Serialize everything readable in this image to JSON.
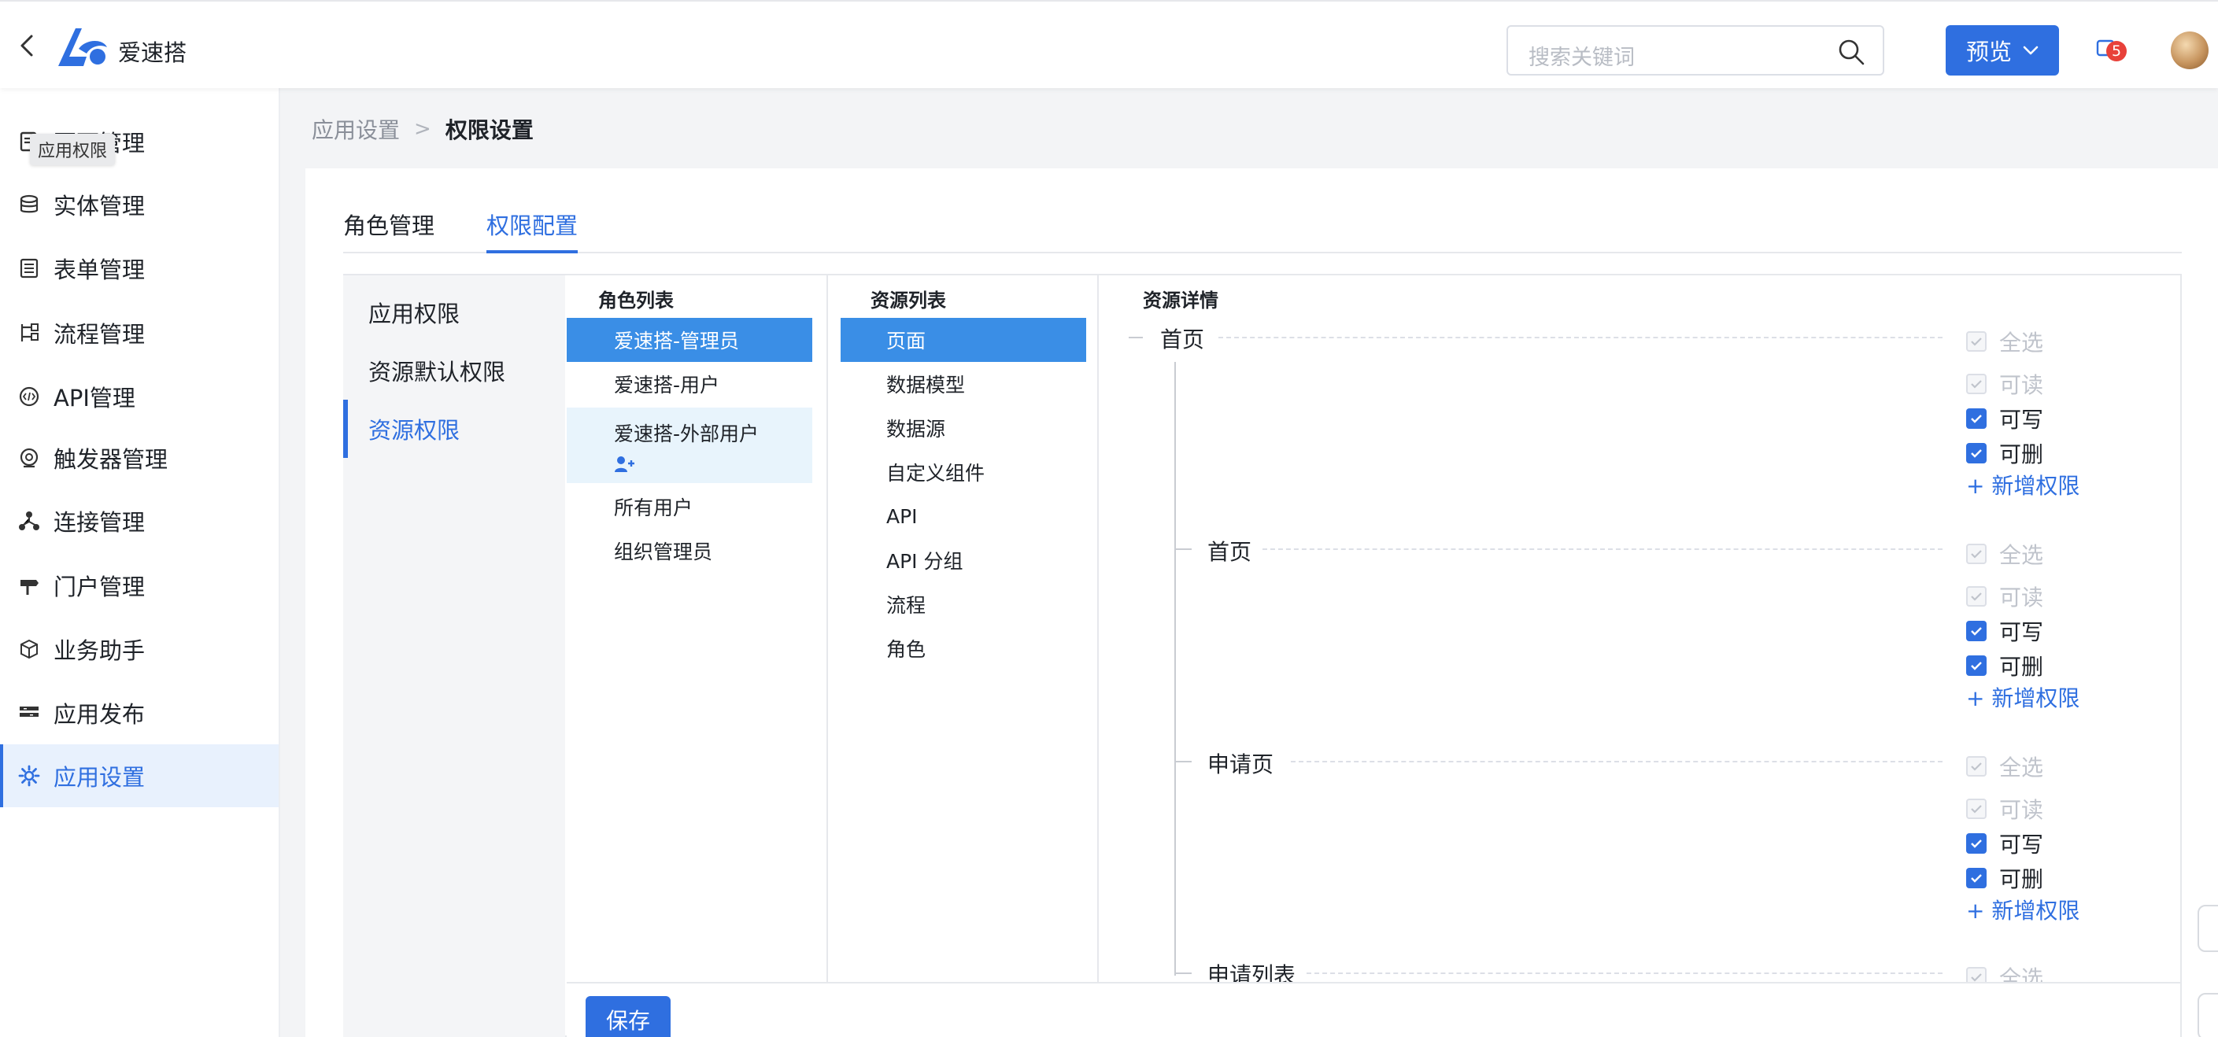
{
  "header": {
    "app_name": "爱速搭",
    "search_placeholder": "搜索关键词",
    "preview_label": "预览",
    "notification_count": "5"
  },
  "sidebar": {
    "tooltip": "应用权限",
    "items": [
      {
        "label": "页面管理",
        "icon": "page-icon"
      },
      {
        "label": "实体管理",
        "icon": "database-icon"
      },
      {
        "label": "表单管理",
        "icon": "form-icon"
      },
      {
        "label": "流程管理",
        "icon": "flow-icon"
      },
      {
        "label": "API管理",
        "icon": "api-icon"
      },
      {
        "label": "触发器管理",
        "icon": "trigger-icon"
      },
      {
        "label": "连接管理",
        "icon": "connection-icon"
      },
      {
        "label": "门户管理",
        "icon": "portal-icon"
      },
      {
        "label": "业务助手",
        "icon": "assistant-icon"
      },
      {
        "label": "应用发布",
        "icon": "publish-icon"
      },
      {
        "label": "应用设置",
        "icon": "gear-icon",
        "active": true
      }
    ]
  },
  "breadcrumb": {
    "parent": "应用设置",
    "separator": ">",
    "current": "权限设置"
  },
  "tabs": [
    "角色管理",
    "权限配置"
  ],
  "left_menu": [
    "应用权限",
    "资源默认权限",
    "资源权限"
  ],
  "roles": {
    "title": "角色列表",
    "items": [
      "爱速搭-管理员",
      "爱速搭-用户",
      "爱速搭-外部用户",
      "所有用户",
      "组织管理员"
    ]
  },
  "resources": {
    "title": "资源列表",
    "items": [
      "页面",
      "数据模型",
      "数据源",
      "自定义组件",
      "API",
      "API 分组",
      "流程",
      "角色"
    ]
  },
  "detail": {
    "title": "资源详情",
    "perm_labels": {
      "all": "全选",
      "read": "可读",
      "write": "可写",
      "delete": "可删"
    },
    "add_label": "+ 新增权限",
    "nodes": [
      "首页",
      "首页",
      "申请页",
      "申请列表"
    ]
  },
  "footer": {
    "save_label": "保存"
  },
  "colors": {
    "primary": "#2f6fe0",
    "selected_row": "#3a8ee6",
    "badge": "#e8413a"
  }
}
